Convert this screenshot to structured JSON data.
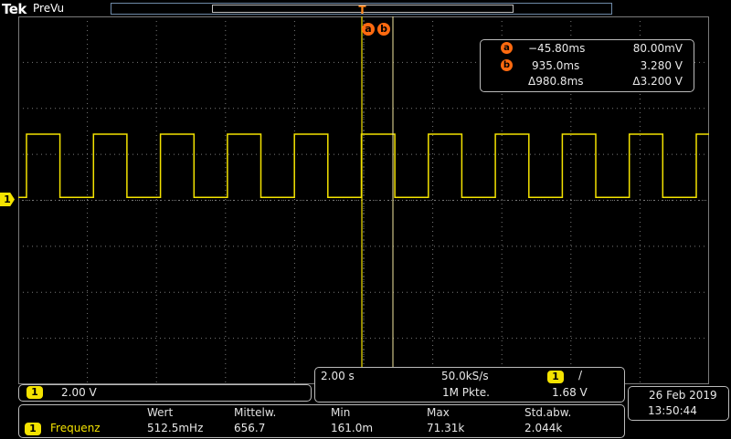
{
  "header": {
    "brand": "Tek",
    "mode": "PreVu"
  },
  "cursors": {
    "a_label": "a",
    "b_label": "b",
    "a_time": "−45.80ms",
    "a_volt": "80.00mV",
    "b_time": "935.0ms",
    "b_volt": "3.280 V",
    "delta_time": "Δ980.8ms",
    "delta_volt": "Δ3.200 V"
  },
  "trigger_marker": "T",
  "channel": {
    "number": "1",
    "scale": "2.00 V"
  },
  "acquisition": {
    "timebase": "2.00 s",
    "sample_rate": "50.0kS/s",
    "trigger_channel": "1",
    "trigger_slope": "/",
    "record_length": "1M Pkte.",
    "trigger_level": "1.68 V"
  },
  "datetime": {
    "date": "26 Feb  2019",
    "time": "13:50:44"
  },
  "measurements": {
    "headers": [
      "Wert",
      "Mittelw.",
      "Min",
      "Max",
      "Std.abw."
    ],
    "row": {
      "channel": "1",
      "name": "Frequenz",
      "values": [
        "512.5mHz",
        "656.7",
        "161.0m",
        "71.31k",
        "2.044k"
      ]
    }
  },
  "colors": {
    "ch1": "#f4e300",
    "cursor": "#ff6a10",
    "grid": "#7a7a7a",
    "panel_border": "#bbbbbb"
  },
  "waveform": {
    "type": "square",
    "frequency": "512.5mHz",
    "high_level_v": 3.28,
    "low_level_v": 0.08,
    "volts_per_div": 2.0,
    "seconds_per_div": 2.0
  }
}
